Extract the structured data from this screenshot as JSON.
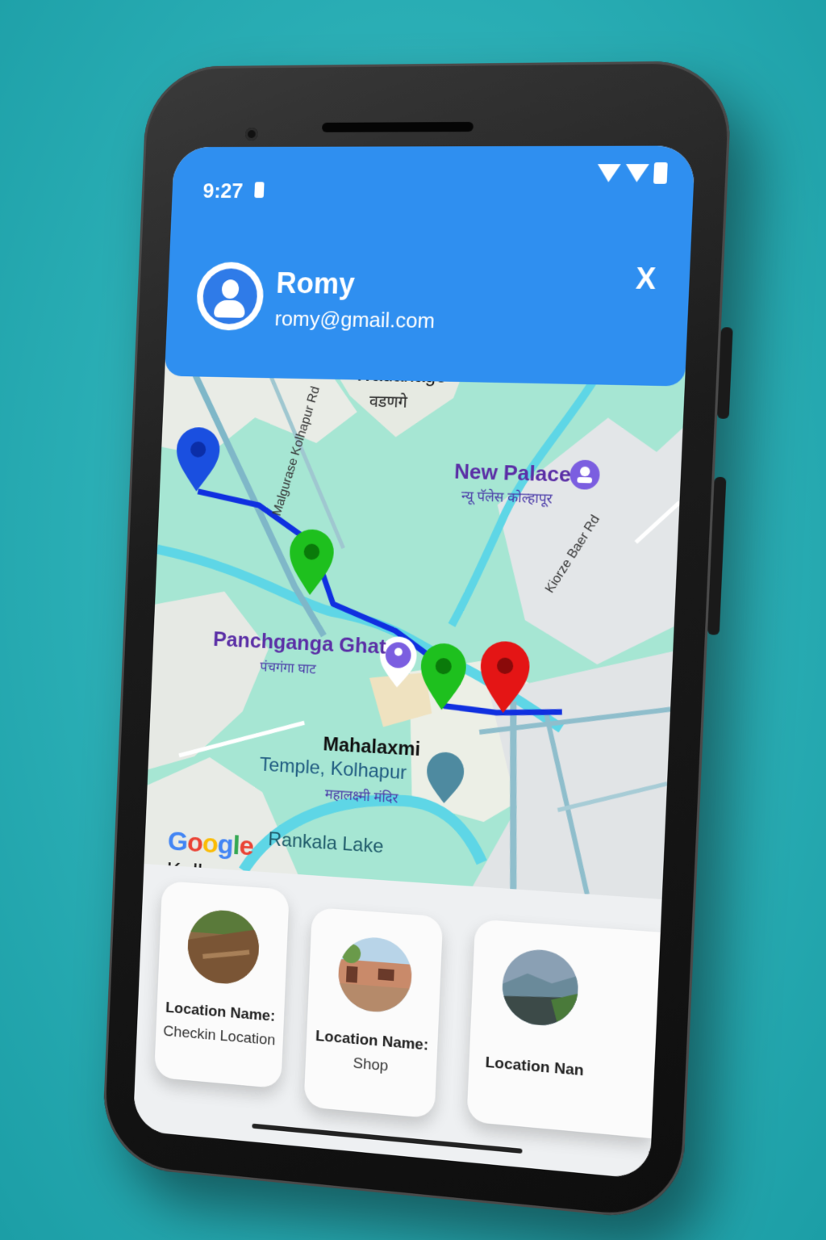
{
  "status_bar": {
    "time": "9:27"
  },
  "header": {
    "user_name": "Romy",
    "user_email": "romy@gmail.com",
    "close_label": "X"
  },
  "map": {
    "labels": {
      "wadanage": "Wadanage",
      "wadanage_local": "वडणगे",
      "road_left": "Malgurase Kolhapur Rd",
      "new_palace": "New Palace",
      "new_palace_local": "न्यू पॅलेस कोल्हापूर",
      "road_right": "Kiorze Baer Rd",
      "panchganga": "Panchganga Ghat",
      "panchganga_local": "पंचगंगा घाट",
      "mahalaxmi": "Mahalaxmi",
      "temple": "Temple, Kolhapur",
      "temple_local": "महालक्ष्मी मंदिर",
      "rankala": "Rankala Lake"
    },
    "watermark": "Google",
    "city": "Kolhapur",
    "marker_colors": {
      "start": "#1a4fe0",
      "checkpoint": "#1ec01e",
      "end": "#e41515",
      "route": "#1030e0"
    }
  },
  "locations": [
    {
      "title": "Location Name:",
      "name": "Checkin Location",
      "icon": "dirt-road-photo"
    },
    {
      "title": "Location Name:",
      "name": "Shop",
      "icon": "shop-photo"
    },
    {
      "title": "Location Nan",
      "name": "",
      "icon": "hills-photo"
    }
  ]
}
